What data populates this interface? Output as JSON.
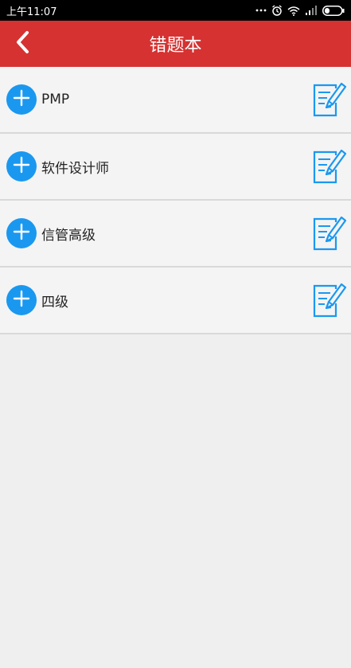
{
  "status_bar": {
    "time": "上午11:07",
    "icons": [
      "more-dots-icon",
      "alarm-icon",
      "wifi-icon",
      "signal-icon",
      "battery-icon"
    ]
  },
  "app_bar": {
    "title": "错题本",
    "back_icon": "chevron-left-icon",
    "color": "#d63232"
  },
  "list": {
    "items": [
      {
        "label": "PMP",
        "add_icon": "plus-icon",
        "edit_icon": "edit-note-icon"
      },
      {
        "label": "软件设计师",
        "add_icon": "plus-icon",
        "edit_icon": "edit-note-icon"
      },
      {
        "label": "信管高级",
        "add_icon": "plus-icon",
        "edit_icon": "edit-note-icon"
      },
      {
        "label": "四级",
        "add_icon": "plus-icon",
        "edit_icon": "edit-note-icon"
      }
    ]
  },
  "colors": {
    "accent_blue": "#1a98f0",
    "header_red": "#d63232",
    "background": "#efefef"
  }
}
